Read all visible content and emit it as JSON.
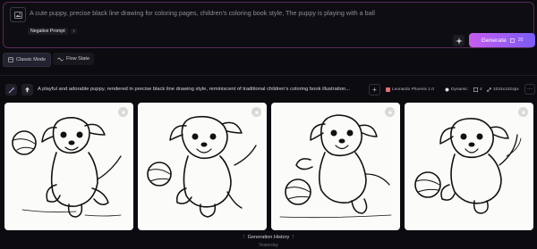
{
  "prompt": {
    "text": "A cute puppy, precise black line drawing for coloring pages, children's coloring book style, The puppy is playing with a ball",
    "negative_prompt_label": "Negative Prompt",
    "negative_chevron": "‹"
  },
  "generate": {
    "label": "Generate",
    "cost": "20"
  },
  "modes": [
    {
      "label": "Classic Mode",
      "icon": "classic-mode-icon",
      "active": true
    },
    {
      "label": "Flow State",
      "icon": "flow-state-icon",
      "active": false
    }
  ],
  "generation": {
    "prompt": "A playful and adorable puppy, rendered in precise black line drawing style, reminiscent of traditional children's coloring book illustration...",
    "model": "Leonardo Phoenix 1.0",
    "style": "Dynamic",
    "count": "4",
    "size": "1024x1024px",
    "plus": "+",
    "more": "···"
  },
  "images": [
    {
      "alt": "puppy-coloring-1"
    },
    {
      "alt": "puppy-coloring-2"
    },
    {
      "alt": "puppy-coloring-3"
    },
    {
      "alt": "puppy-coloring-4"
    }
  ],
  "history": {
    "title": "Generation History",
    "subtitle": "Yesterday"
  },
  "colors": {
    "accent_start": "#c75cf0",
    "accent_end": "#7a5cf6",
    "background": "#0b0b10"
  }
}
